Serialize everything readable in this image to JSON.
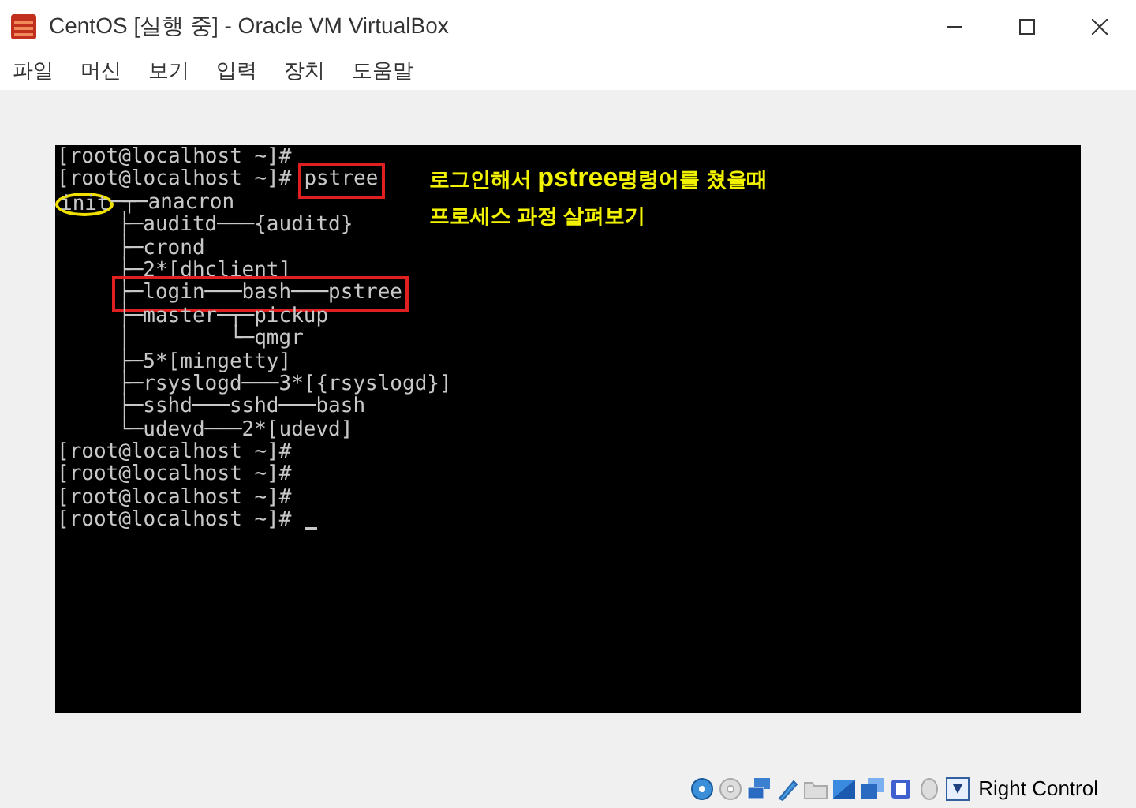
{
  "window": {
    "title": "CentOS [실행 중] - Oracle VM VirtualBox"
  },
  "menu": [
    "파일",
    "머신",
    "보기",
    "입력",
    "장치",
    "도움말"
  ],
  "terminal": {
    "lines": [
      {
        "kind": "prompt",
        "text": "[root@localhost ~]#"
      },
      {
        "kind": "prompt",
        "text": "[root@localhost ~]#",
        "command": "pstree",
        "boxed": true
      },
      {
        "kind": "tree-root",
        "text": "init",
        "circled": true,
        "rest": "─┬─anacron"
      },
      {
        "kind": "tree",
        "text": "├─auditd───{auditd}",
        "boxed": false
      },
      {
        "kind": "tree",
        "text": "├─crond",
        "boxed": false
      },
      {
        "kind": "tree",
        "text": "├─2*[dhclient]",
        "boxed": false
      },
      {
        "kind": "tree",
        "text": "├─login───bash───pstree",
        "boxed": true
      },
      {
        "kind": "tree",
        "text": "├─master─┬─pickup",
        "boxed": false
      },
      {
        "kind": "tree",
        "text": "│        └─qmgr",
        "boxed": false
      },
      {
        "kind": "tree",
        "text": "├─5*[mingetty]",
        "boxed": false
      },
      {
        "kind": "tree",
        "text": "├─rsyslogd───3*[{rsyslogd}]",
        "boxed": false
      },
      {
        "kind": "tree",
        "text": "├─sshd───sshd───bash",
        "boxed": false
      },
      {
        "kind": "tree",
        "text": "└─udevd───2*[udevd]",
        "boxed": false
      },
      {
        "kind": "prompt",
        "text": "[root@localhost ~]#"
      },
      {
        "kind": "prompt",
        "text": "[root@localhost ~]#"
      },
      {
        "kind": "prompt",
        "text": "[root@localhost ~]#"
      },
      {
        "kind": "prompt",
        "text": "[root@localhost ~]#"
      }
    ],
    "cursor": true,
    "annotation": [
      "로그인해서 **pstree**명령어를 쳤을때",
      "프로세스 과정 살펴보기"
    ]
  },
  "status_bar": {
    "host_key": "Right Control"
  }
}
